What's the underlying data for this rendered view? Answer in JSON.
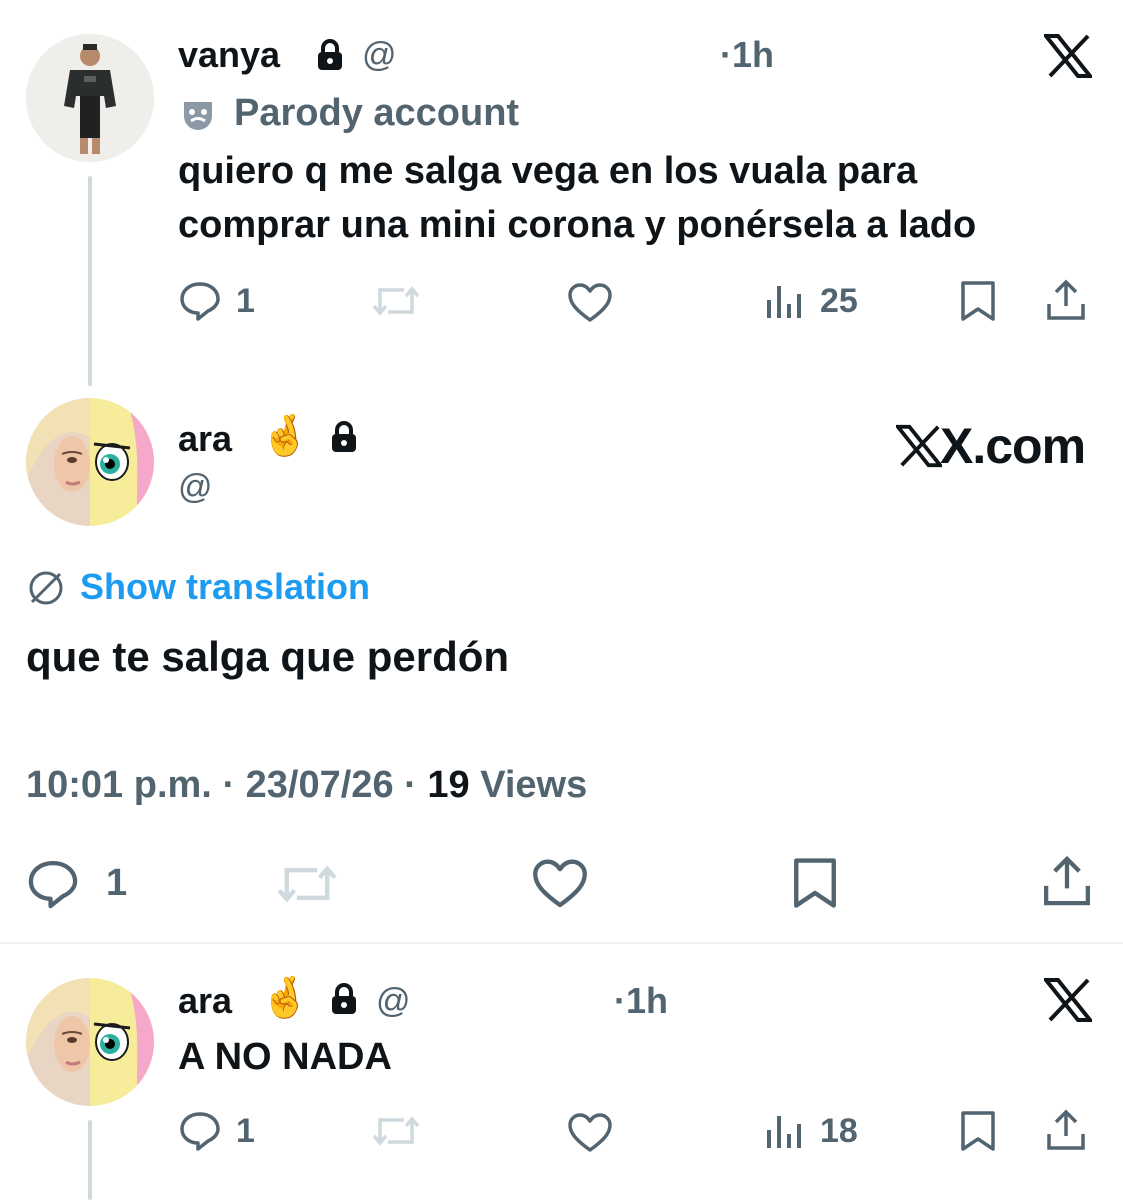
{
  "tweet1": {
    "name": "vanya",
    "handle": "@",
    "time": "·1h",
    "parody_label": "Parody account",
    "text_line1": "quiero q me salga vega en los vuala para",
    "text_line2": "comprar una mini corona y ponérsela a lado",
    "replies": "1",
    "views": "25"
  },
  "tweet2": {
    "name": "ara",
    "handle": "@",
    "brand": "X.com",
    "show_translation": "Show translation",
    "text": "que te salga que perdón",
    "time": "10:01 p.m.",
    "date": "23/07/26",
    "views_count": "19",
    "views_label": "Views",
    "replies": "1"
  },
  "tweet3": {
    "name": "ara",
    "handle": "@",
    "time": "·1h",
    "text": "A NO NADA",
    "replies": "1",
    "views": "18"
  },
  "colors": {
    "text": "#0f1419",
    "secondary": "#536471",
    "link": "#1d9bf0",
    "divider": "#eff3f4",
    "thread_line": "#cfd9de"
  },
  "icons": [
    "lock-icon",
    "x-logo-icon",
    "parody-mask-icon",
    "reply-icon",
    "retweet-icon",
    "like-icon",
    "views-icon",
    "bookmark-icon",
    "share-icon",
    "translate-icon",
    "crossed-fingers-emoji"
  ]
}
